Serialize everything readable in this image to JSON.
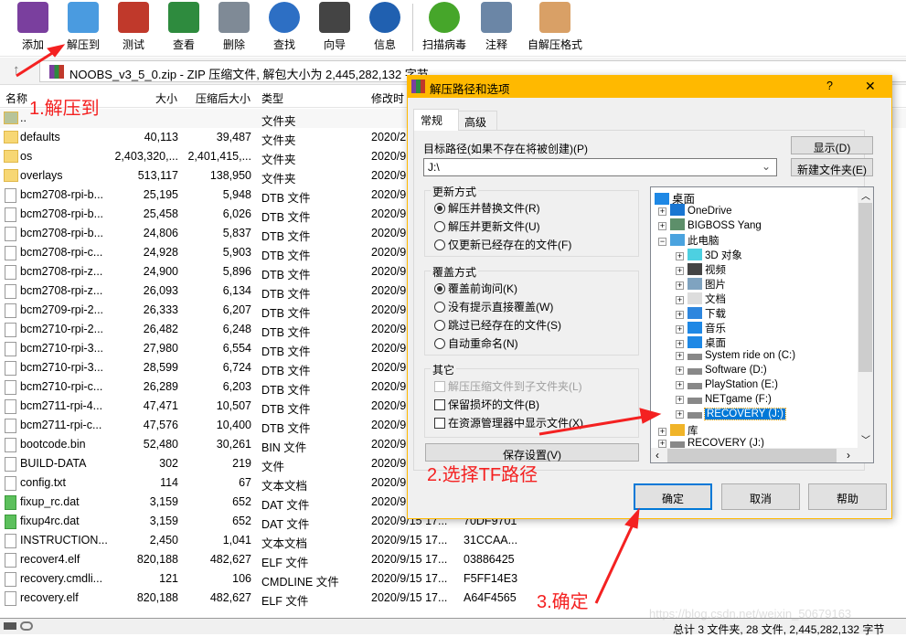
{
  "toolbar": {
    "items": [
      {
        "label": "添加",
        "icon": "archive-add-icon",
        "color": "#7a3f9e"
      },
      {
        "label": "解压到",
        "icon": "extract-folder-icon",
        "color": "#4a9be0"
      },
      {
        "label": "测试",
        "icon": "test-clipboard-icon",
        "color": "#c0392b"
      },
      {
        "label": "查看",
        "icon": "view-book-icon",
        "color": "#2e8b3e"
      },
      {
        "label": "删除",
        "icon": "trash-icon",
        "color": "#7f8a96"
      },
      {
        "label": "查找",
        "icon": "search-magnifier-icon",
        "color": "#2d6fc4"
      },
      {
        "label": "向导",
        "icon": "wizard-wand-icon",
        "color": "#444444"
      },
      {
        "label": "信息",
        "icon": "info-icon",
        "color": "#2060b0"
      },
      {
        "label": "扫描病毒",
        "icon": "virus-scan-icon",
        "color": "#46a62a"
      },
      {
        "label": "注释",
        "icon": "comment-icon",
        "color": "#6b86a6"
      },
      {
        "label": "自解压格式",
        "icon": "sfx-box-icon",
        "color": "#d9a066"
      }
    ]
  },
  "address": {
    "text": "NOOBS_v3_5_0.zip - ZIP 压缩文件, 解包大小为 2,445,282,132 字节"
  },
  "columns": {
    "name": "名称",
    "size": "大小",
    "packed": "压缩后大小",
    "type": "类型",
    "modified": "修改时"
  },
  "files": [
    {
      "name": "..",
      "size": "",
      "packed": "",
      "type": "文件夹",
      "modified": "",
      "crc": "",
      "kind": "parent"
    },
    {
      "name": "defaults",
      "size": "40,113",
      "packed": "39,487",
      "type": "文件夹",
      "modified": "2020/2",
      "crc": "",
      "kind": "folder"
    },
    {
      "name": "os",
      "size": "2,403,320,...",
      "packed": "2,401,415,...",
      "type": "文件夹",
      "modified": "2020/9",
      "crc": "",
      "kind": "folder"
    },
    {
      "name": "overlays",
      "size": "513,117",
      "packed": "138,950",
      "type": "文件夹",
      "modified": "2020/9",
      "crc": "",
      "kind": "folder"
    },
    {
      "name": "bcm2708-rpi-b...",
      "size": "25,195",
      "packed": "5,948",
      "type": "DTB 文件",
      "modified": "2020/9",
      "crc": "",
      "kind": "file"
    },
    {
      "name": "bcm2708-rpi-b...",
      "size": "25,458",
      "packed": "6,026",
      "type": "DTB 文件",
      "modified": "2020/9",
      "crc": "",
      "kind": "file"
    },
    {
      "name": "bcm2708-rpi-b...",
      "size": "24,806",
      "packed": "5,837",
      "type": "DTB 文件",
      "modified": "2020/9",
      "crc": "",
      "kind": "file"
    },
    {
      "name": "bcm2708-rpi-c...",
      "size": "24,928",
      "packed": "5,903",
      "type": "DTB 文件",
      "modified": "2020/9",
      "crc": "",
      "kind": "file"
    },
    {
      "name": "bcm2708-rpi-z...",
      "size": "24,900",
      "packed": "5,896",
      "type": "DTB 文件",
      "modified": "2020/9",
      "crc": "",
      "kind": "file"
    },
    {
      "name": "bcm2708-rpi-z...",
      "size": "26,093",
      "packed": "6,134",
      "type": "DTB 文件",
      "modified": "2020/9",
      "crc": "",
      "kind": "file"
    },
    {
      "name": "bcm2709-rpi-2...",
      "size": "26,333",
      "packed": "6,207",
      "type": "DTB 文件",
      "modified": "2020/9",
      "crc": "",
      "kind": "file"
    },
    {
      "name": "bcm2710-rpi-2...",
      "size": "26,482",
      "packed": "6,248",
      "type": "DTB 文件",
      "modified": "2020/9",
      "crc": "",
      "kind": "file"
    },
    {
      "name": "bcm2710-rpi-3...",
      "size": "27,980",
      "packed": "6,554",
      "type": "DTB 文件",
      "modified": "2020/9",
      "crc": "",
      "kind": "file"
    },
    {
      "name": "bcm2710-rpi-3...",
      "size": "28,599",
      "packed": "6,724",
      "type": "DTB 文件",
      "modified": "2020/9",
      "crc": "",
      "kind": "file"
    },
    {
      "name": "bcm2710-rpi-c...",
      "size": "26,289",
      "packed": "6,203",
      "type": "DTB 文件",
      "modified": "2020/9",
      "crc": "",
      "kind": "file"
    },
    {
      "name": "bcm2711-rpi-4...",
      "size": "47,471",
      "packed": "10,507",
      "type": "DTB 文件",
      "modified": "2020/9",
      "crc": "",
      "kind": "file"
    },
    {
      "name": "bcm2711-rpi-c...",
      "size": "47,576",
      "packed": "10,400",
      "type": "DTB 文件",
      "modified": "2020/9",
      "crc": "",
      "kind": "file"
    },
    {
      "name": "bootcode.bin",
      "size": "52,480",
      "packed": "30,261",
      "type": "BIN 文件",
      "modified": "2020/9",
      "crc": "",
      "kind": "file"
    },
    {
      "name": "BUILD-DATA",
      "size": "302",
      "packed": "219",
      "type": "文件",
      "modified": "2020/9",
      "crc": "",
      "kind": "file"
    },
    {
      "name": "config.txt",
      "size": "114",
      "packed": "67",
      "type": "文本文档",
      "modified": "2020/9",
      "crc": "",
      "kind": "text"
    },
    {
      "name": "fixup_rc.dat",
      "size": "3,159",
      "packed": "652",
      "type": "DAT 文件",
      "modified": "2020/9",
      "crc": "",
      "kind": "dat"
    },
    {
      "name": "fixup4rc.dat",
      "size": "3,159",
      "packed": "652",
      "type": "DAT 文件",
      "modified": "2020/9/15 17...",
      "crc": "70DF9701",
      "kind": "dat"
    },
    {
      "name": "INSTRUCTION...",
      "size": "2,450",
      "packed": "1,041",
      "type": "文本文档",
      "modified": "2020/9/15 17...",
      "crc": "31CCAA...",
      "kind": "text"
    },
    {
      "name": "recover4.elf",
      "size": "820,188",
      "packed": "482,627",
      "type": "ELF 文件",
      "modified": "2020/9/15 17...",
      "crc": "03886425",
      "kind": "file"
    },
    {
      "name": "recovery.cmdli...",
      "size": "121",
      "packed": "106",
      "type": "CMDLINE 文件",
      "modified": "2020/9/15 17...",
      "crc": "F5FF14E3",
      "kind": "file"
    },
    {
      "name": "recovery.elf",
      "size": "820,188",
      "packed": "482,627",
      "type": "ELF 文件",
      "modified": "2020/9/15 17...",
      "crc": "A64F4565",
      "kind": "file"
    }
  ],
  "status": {
    "text": "总计 3 文件夹, 28 文件, 2,445,282,132 字节"
  },
  "dialog": {
    "title": "解压路径和选项",
    "help": "?",
    "close": "✕",
    "tabs": [
      "常规",
      "高级"
    ],
    "path_label": "目标路径(如果不存在将被创建)(P)",
    "path_value": "J:\\",
    "show_btn": "显示(D)",
    "new_folder_btn": "新建文件夹(E)",
    "update": {
      "legend": "更新方式",
      "options": [
        "解压并替换文件(R)",
        "解压并更新文件(U)",
        "仅更新已经存在的文件(F)"
      ],
      "selected": 0
    },
    "overwrite": {
      "legend": "覆盖方式",
      "options": [
        "覆盖前询问(K)",
        "没有提示直接覆盖(W)",
        "跳过已经存在的文件(S)",
        "自动重命名(N)"
      ],
      "selected": 0
    },
    "misc": {
      "legend": "其它",
      "options": [
        {
          "label": "解压压缩文件到子文件夹(L)",
          "checked": false,
          "disabled": true
        },
        {
          "label": "保留损坏的文件(B)",
          "checked": false,
          "disabled": false
        },
        {
          "label": "在资源管理器中显示文件(X)",
          "checked": false,
          "disabled": false
        }
      ]
    },
    "save_btn": "保存设置(V)",
    "tree": [
      {
        "label": "桌面",
        "level": 0,
        "exp": "",
        "icon": "desktop-icon"
      },
      {
        "label": "OneDrive",
        "level": 1,
        "exp": "+",
        "icon": "cloud-icon"
      },
      {
        "label": "BIGBOSS Yang",
        "level": 1,
        "exp": "+",
        "icon": "user-icon"
      },
      {
        "label": "此电脑",
        "level": 1,
        "exp": "-",
        "icon": "computer-icon"
      },
      {
        "label": "3D 对象",
        "level": 2,
        "exp": "+",
        "icon": "cube-icon"
      },
      {
        "label": "视频",
        "level": 2,
        "exp": "+",
        "icon": "video-icon"
      },
      {
        "label": "图片",
        "level": 2,
        "exp": "+",
        "icon": "picture-icon"
      },
      {
        "label": "文档",
        "level": 2,
        "exp": "+",
        "icon": "document-icon"
      },
      {
        "label": "下载",
        "level": 2,
        "exp": "+",
        "icon": "download-icon"
      },
      {
        "label": "音乐",
        "level": 2,
        "exp": "+",
        "icon": "music-icon"
      },
      {
        "label": "桌面",
        "level": 2,
        "exp": "+",
        "icon": "desktop-icon"
      },
      {
        "label": "System ride on (C:)",
        "level": 2,
        "exp": "+",
        "icon": "drive-icon"
      },
      {
        "label": "Software (D:)",
        "level": 2,
        "exp": "+",
        "icon": "drive-icon"
      },
      {
        "label": "PlayStation (E:)",
        "level": 2,
        "exp": "+",
        "icon": "drive-icon"
      },
      {
        "label": "NETgame (F:)",
        "level": 2,
        "exp": "+",
        "icon": "drive-icon"
      },
      {
        "label": "RECOVERY (J:)",
        "level": 2,
        "exp": "+",
        "icon": "drive-icon",
        "selected": true
      },
      {
        "label": "库",
        "level": 1,
        "exp": "+",
        "icon": "library-icon"
      },
      {
        "label": "RECOVERY (J:)",
        "level": 1,
        "exp": "+",
        "icon": "drive-icon"
      }
    ],
    "ok": "确定",
    "cancel": "取消",
    "help_btn": "帮助"
  },
  "annotations": [
    "1.解压到",
    "2.选择TF路径",
    "3.确定"
  ],
  "watermark": "https://blog.csdn.net/weixin_50679163",
  "colors": {
    "title_bar": "#FFB900",
    "selection": "#0078D7",
    "annotation": "#F42121"
  }
}
